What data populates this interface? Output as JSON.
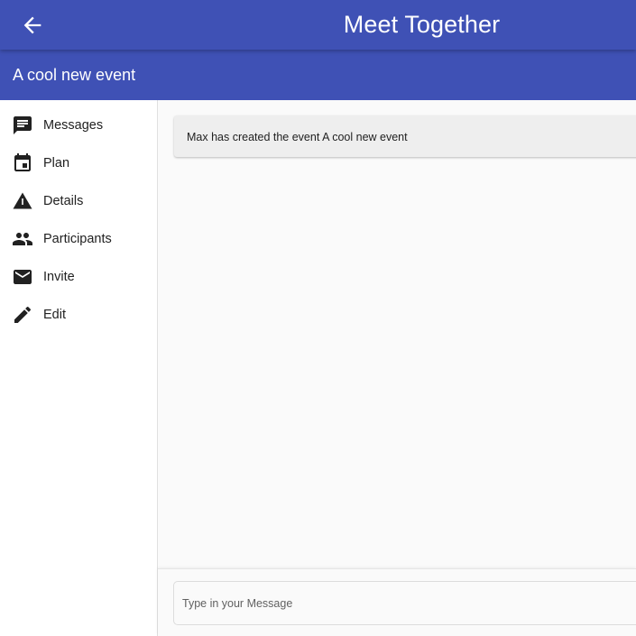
{
  "header": {
    "title": "Meet Together",
    "back_icon": "arrow-back-icon",
    "color": "#3f51b5"
  },
  "event": {
    "title": "A cool new event"
  },
  "sidebar": {
    "items": [
      {
        "label": "Messages",
        "icon": "message-icon"
      },
      {
        "label": "Plan",
        "icon": "calendar-icon"
      },
      {
        "label": "Details",
        "icon": "warning-triangle-icon"
      },
      {
        "label": "Participants",
        "icon": "people-icon"
      },
      {
        "label": "Invite",
        "icon": "mail-icon"
      },
      {
        "label": "Edit",
        "icon": "pencil-icon"
      }
    ]
  },
  "chat": {
    "messages": [
      {
        "text": "Max has created the event A cool new event"
      }
    ]
  },
  "composer": {
    "placeholder": "Type in your Message",
    "value": ""
  }
}
